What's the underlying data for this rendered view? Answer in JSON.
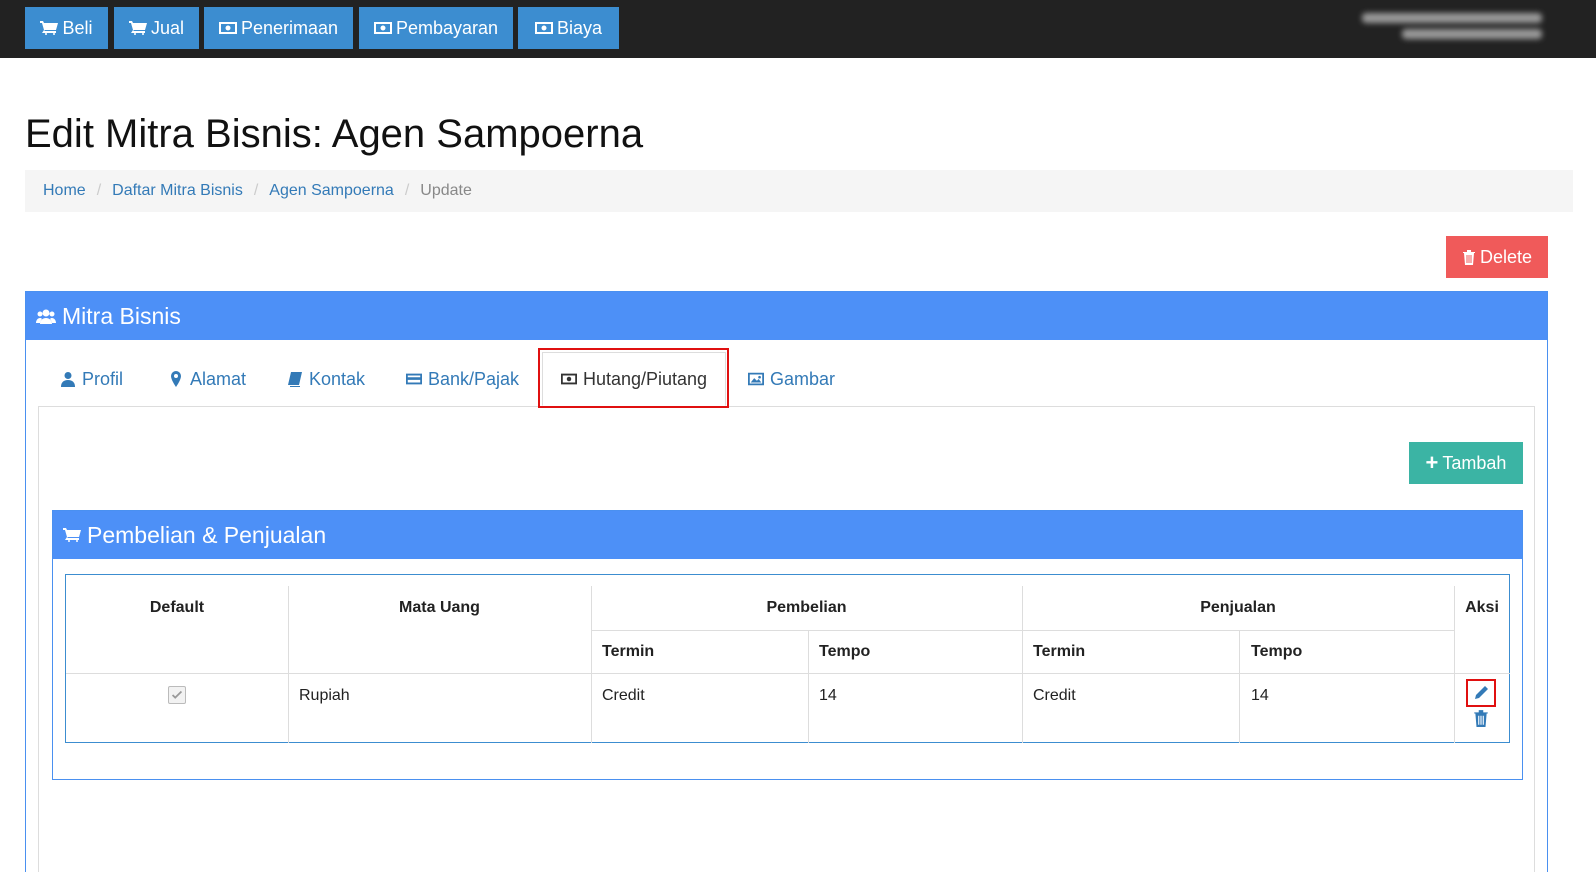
{
  "topbar": {
    "buttons": [
      {
        "label": "Beli",
        "icon": "cart-icon"
      },
      {
        "label": "Jual",
        "icon": "cart-icon"
      },
      {
        "label": "Penerimaan",
        "icon": "money-icon"
      },
      {
        "label": "Pembayaran",
        "icon": "money-icon"
      },
      {
        "label": "Biaya",
        "icon": "money-icon"
      }
    ]
  },
  "page": {
    "title": "Edit Mitra Bisnis: Agen Sampoerna",
    "breadcrumb": [
      "Home",
      "Daftar Mitra Bisnis",
      "Agen Sampoerna",
      "Update"
    ],
    "delete_label": "Delete"
  },
  "panel": {
    "title": "Mitra Bisnis",
    "tabs": [
      {
        "label": "Profil",
        "icon": "user-icon"
      },
      {
        "label": "Alamat",
        "icon": "map-marker-icon"
      },
      {
        "label": "Kontak",
        "icon": "book-icon"
      },
      {
        "label": "Bank/Pajak",
        "icon": "credit-card-icon"
      },
      {
        "label": "Hutang/Piutang",
        "icon": "money-icon"
      },
      {
        "label": "Gambar",
        "icon": "picture-icon"
      }
    ],
    "active_tab": "Hutang/Piutang"
  },
  "content": {
    "add_label": "Tambah",
    "section_title": "Pembelian & Penjualan",
    "table": {
      "headers": {
        "default": "Default",
        "mata_uang": "Mata Uang",
        "pembelian": "Pembelian",
        "penjualan": "Penjualan",
        "aksi": "Aksi",
        "termin": "Termin",
        "tempo": "Tempo"
      },
      "rows": [
        {
          "default": true,
          "mata_uang": "Rupiah",
          "beli_termin": "Credit",
          "beli_tempo": "14",
          "jual_termin": "Credit",
          "jual_tempo": "14"
        }
      ]
    }
  },
  "colors": {
    "primary": "#4d90f7",
    "danger": "#f05a5a",
    "success": "#3bb4a4",
    "topbar": "#222222",
    "highlight": "#e01010"
  }
}
